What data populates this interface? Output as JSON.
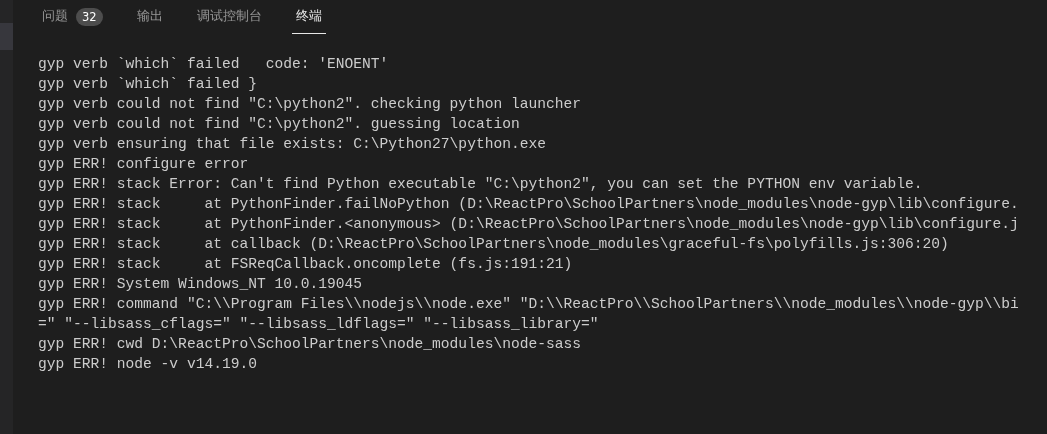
{
  "tabs": [
    {
      "label": "问题",
      "badge": "32",
      "selected": false
    },
    {
      "label": "输出",
      "selected": false
    },
    {
      "label": "调试控制台",
      "selected": false
    },
    {
      "label": "终端",
      "selected": true
    }
  ],
  "terminal": {
    "lines": [
      "gyp verb `which` failed   code: 'ENOENT'",
      "gyp verb `which` failed }",
      "gyp verb could not find \"C:\\python2\". checking python launcher",
      "gyp verb could not find \"C:\\python2\". guessing location",
      "gyp verb ensuring that file exists: C:\\Python27\\python.exe",
      "gyp ERR! configure error",
      "gyp ERR! stack Error: Can't find Python executable \"C:\\python2\", you can set the PYTHON env variable.",
      "gyp ERR! stack     at PythonFinder.failNoPython (D:\\ReactPro\\SchoolPartners\\node_modules\\node-gyp\\lib\\configure.",
      "gyp ERR! stack     at PythonFinder.<anonymous> (D:\\ReactPro\\SchoolPartners\\node_modules\\node-gyp\\lib\\configure.j",
      "gyp ERR! stack     at callback (D:\\ReactPro\\SchoolPartners\\node_modules\\graceful-fs\\polyfills.js:306:20)",
      "gyp ERR! stack     at FSReqCallback.oncomplete (fs.js:191:21)",
      "gyp ERR! System Windows_NT 10.0.19045",
      "gyp ERR! command \"C:\\\\Program Files\\\\nodejs\\\\node.exe\" \"D:\\\\ReactPro\\\\SchoolPartners\\\\node_modules\\\\node-gyp\\\\bi",
      "=\" \"--libsass_cflags=\" \"--libsass_ldflags=\" \"--libsass_library=\"",
      "gyp ERR! cwd D:\\ReactPro\\SchoolPartners\\node_modules\\node-sass",
      "gyp ERR! node -v v14.19.0"
    ]
  }
}
